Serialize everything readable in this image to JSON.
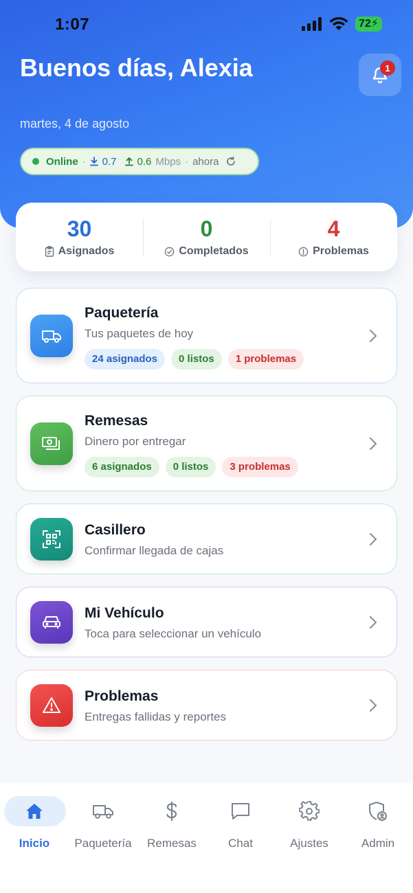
{
  "status_bar": {
    "time": "1:07",
    "battery": "72"
  },
  "header": {
    "greeting": "Buenos días, Alexia",
    "date": "martes, 4 de agosto",
    "notifications_count": "1"
  },
  "network": {
    "status": "Online",
    "separator": "·",
    "download": "0.7",
    "upload": "0.6",
    "unit": "Mbps",
    "updated": "ahora"
  },
  "stats": [
    {
      "value": "30",
      "label": "Asignados",
      "color": "#2a6fd4"
    },
    {
      "value": "0",
      "label": "Completados",
      "color": "#2e8f3a"
    },
    {
      "value": "4",
      "label": "Problemas",
      "color": "#d63a3a"
    }
  ],
  "modules": [
    {
      "title": "Paquetería",
      "subtitle": "Tus paquetes de hoy",
      "tags": [
        "24 asignados",
        "0 listos",
        "1 problemas"
      ]
    },
    {
      "title": "Remesas",
      "subtitle": "Dinero por entregar",
      "tags": [
        "6 asignados",
        "0 listos",
        "3 problemas"
      ]
    },
    {
      "title": "Casillero",
      "subtitle": "Confirmar llegada de cajas"
    },
    {
      "title": "Mi Vehículo",
      "subtitle": "Toca para seleccionar un vehículo"
    },
    {
      "title": "Problemas",
      "subtitle": "Entregas fallidas y reportes"
    }
  ],
  "tabs": [
    {
      "label": "Inicio",
      "icon": "home-icon",
      "active": true
    },
    {
      "label": "Paquetería",
      "icon": "truck-icon"
    },
    {
      "label": "Remesas",
      "icon": "dollar-icon"
    },
    {
      "label": "Chat",
      "icon": "chat-icon"
    },
    {
      "label": "Ajustes",
      "icon": "gear-icon"
    },
    {
      "label": "Admin",
      "icon": "shield-user-icon"
    }
  ],
  "colors": {
    "primary": "#3b82f6",
    "paqueteria": "#3b8ff0",
    "remesas": "#4caf50",
    "casillero": "#1f9e8a",
    "vehiculo": "#6a45c9",
    "problemas": "#e53935"
  }
}
